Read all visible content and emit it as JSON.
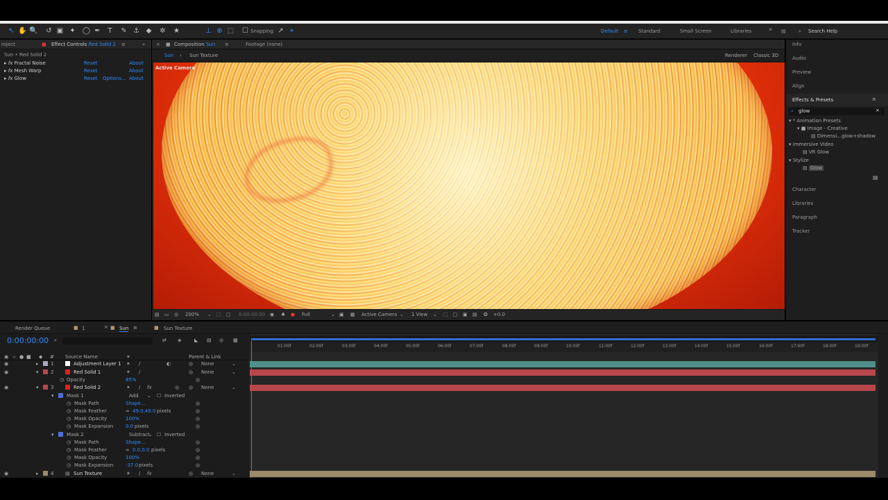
{
  "toolbar": {
    "snapping": "Snapping",
    "workspaces": [
      "Default",
      "Standard",
      "Small Screen",
      "Libraries"
    ],
    "search_help": "Search Help"
  },
  "effect_controls": {
    "project_tab": "roject",
    "tab": "Effect Controls",
    "tab_layer": "Red Solid 2",
    "breadcrumb": "Sun • Red Solid 2",
    "effects": [
      {
        "name": "Fractal Noise",
        "reset": "Reset",
        "options": "",
        "about": "About"
      },
      {
        "name": "Mesh Warp",
        "reset": "Reset",
        "options": "",
        "about": "About"
      },
      {
        "name": "Glow",
        "reset": "Reset",
        "options": "Options...",
        "about": "About"
      }
    ]
  },
  "composition": {
    "tab": "Composition",
    "tab_name": "Sun",
    "footage_tab": "Footage (none)",
    "crumbs": [
      "Sun",
      "Sun Texture"
    ],
    "renderer": "Renderer",
    "renderer_value": "Classic 3D",
    "active_camera": "Active Camera",
    "zoom": "200%",
    "timecode": "0:00:00:00",
    "resolution": "Full",
    "camera_select": "Active Camera",
    "view_select": "1 View",
    "exposure": "+0.0"
  },
  "right_panel": {
    "info": "Info",
    "audio": "Audio",
    "preview": "Preview",
    "align": "Align",
    "effects_presets": "Effects & Presets",
    "search_value": "glow",
    "tree": [
      "* Animation Presets",
      "Image - Creative",
      "Dimensi...glow+shadow",
      "Immersive Video",
      "VR Glow",
      "Stylize",
      "Glow"
    ],
    "character": "Character",
    "libraries": "Libraries",
    "paragraph": "Paragraph",
    "tracker": "Tracker"
  },
  "timeline": {
    "tabs": [
      "Render Queue",
      "1",
      "Sun",
      "Sun Texture"
    ],
    "timecode": "0:00:00:00",
    "col_source": "Source Name",
    "col_parent": "Parent & Link",
    "ruler": [
      "01:00f",
      "02:00f",
      "03:00f",
      "04:00f",
      "05:00f",
      "06:00f",
      "07:00f",
      "08:00f",
      "09:00f",
      "10:00f",
      "11:00f",
      "12:00f",
      "13:00f",
      "14:00f",
      "15:00f",
      "16:00f",
      "17:00f",
      "18:00f",
      "19:00f"
    ],
    "rows": [
      {
        "num": "1",
        "name": "Adjustment Layer 1",
        "parent": "None"
      },
      {
        "num": "2",
        "name": "Red Solid 1",
        "parent": "None"
      },
      {
        "prop": "Opacity",
        "value": "85%"
      },
      {
        "num": "3",
        "name": "Red Solid 2",
        "parent": "None"
      },
      {
        "mask": "Mask 1",
        "mode": "Add",
        "inverted": "Inverted"
      },
      {
        "prop": "Mask Path",
        "value": "Shape..."
      },
      {
        "prop": "Mask Feather",
        "value": "49.0,49.0",
        "unit": "pixels"
      },
      {
        "prop": "Mask Opacity",
        "value": "100%"
      },
      {
        "prop": "Mask Expansion",
        "value": "0.0",
        "unit": "pixels"
      },
      {
        "mask": "Mask 2",
        "mode": "Subtract",
        "inverted": "Inverted"
      },
      {
        "prop": "Mask Path",
        "value": "Shape..."
      },
      {
        "prop": "Mask Feather",
        "value": "0.0,0.0",
        "unit": "pixels"
      },
      {
        "prop": "Mask Opacity",
        "value": "100%"
      },
      {
        "prop": "Mask Expansion",
        "value": "-37.0",
        "unit": "pixels"
      },
      {
        "num": "4",
        "name": "Sun Texture",
        "parent": "None"
      }
    ]
  },
  "colors": {
    "accent": "#2f8cff",
    "solid_red": "#e0221c",
    "track_teal": "#4f8f8a",
    "track_red": "#b8474c",
    "track_tan": "#9b8a6a"
  }
}
